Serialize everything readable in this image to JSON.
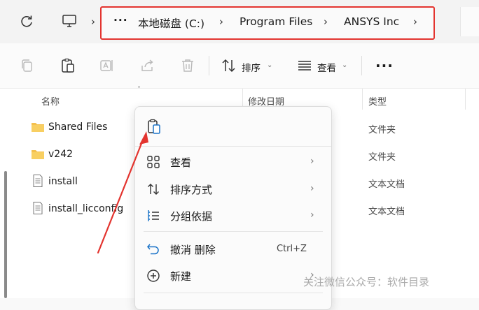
{
  "breadcrumb": {
    "more": "···",
    "items": [
      "本地磁盘 (C:)",
      "Program Files",
      "ANSYS Inc"
    ]
  },
  "toolbar": {
    "sort_label": "排序",
    "view_label": "查看",
    "more_label": "···"
  },
  "columns": {
    "name": "名称",
    "date": "修改日期",
    "type": "类型"
  },
  "files": [
    {
      "name": "Shared Files",
      "type": "文件夹",
      "icon": "folder-icon"
    },
    {
      "name": "v242",
      "type": "文件夹",
      "icon": "folder-icon"
    },
    {
      "name": "install",
      "type": "文本文档",
      "icon": "text-file-icon"
    },
    {
      "name": "install_licconfig",
      "type": "文本文档",
      "icon": "text-file-icon"
    }
  ],
  "context_menu": {
    "items": [
      {
        "label": "查看",
        "icon": "grid-view-icon",
        "submenu": true
      },
      {
        "label": "排序方式",
        "icon": "sort-icon",
        "submenu": true
      },
      {
        "label": "分组依据",
        "icon": "group-icon",
        "submenu": true
      },
      {
        "label": "撤消 删除",
        "icon": "undo-icon",
        "shortcut": "Ctrl+Z"
      },
      {
        "label": "新建",
        "icon": "new-plus-icon",
        "submenu": true
      }
    ]
  },
  "colors": {
    "highlight_border": "#e3342f",
    "annotation_arrow": "#e3342f",
    "folder": "#f4c04e",
    "accent": "#1a73c8"
  },
  "watermark": "关注微信公众号：软件目录"
}
